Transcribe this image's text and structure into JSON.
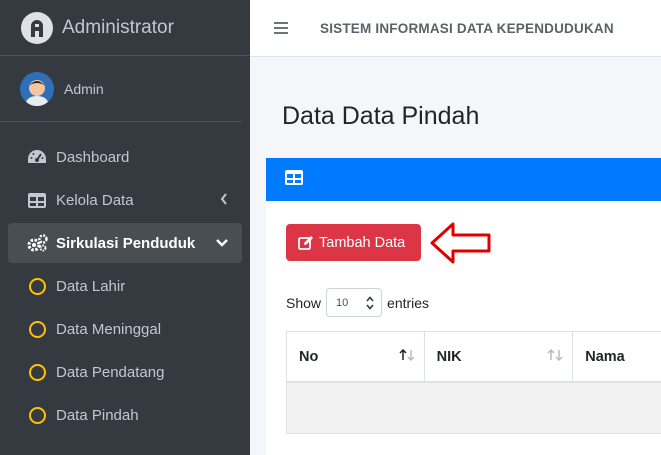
{
  "brand": {
    "title": "Administrator"
  },
  "user": {
    "name": "Admin"
  },
  "sidebar": {
    "items": [
      {
        "label": "Dashboard"
      },
      {
        "label": "Kelola Data"
      },
      {
        "label": "Sirkulasi Penduduk"
      },
      {
        "label": "Data Lahir"
      },
      {
        "label": "Data Meninggal"
      },
      {
        "label": "Data Pendatang"
      },
      {
        "label": "Data Pindah"
      }
    ]
  },
  "topbar": {
    "title": "SISTEM INFORMASI DATA KEPENDUDUKAN"
  },
  "page": {
    "title": "Data Data Pindah"
  },
  "card": {
    "add_button": "Tambah Data",
    "show_label": "Show",
    "entries_value": "10",
    "entries_label": "entries"
  },
  "table": {
    "columns": [
      "No",
      "NIK",
      "Nama"
    ]
  },
  "colors": {
    "sidebar_bg": "#343a40",
    "primary": "#007bff",
    "danger": "#dc3545",
    "warning": "#ffc107"
  }
}
